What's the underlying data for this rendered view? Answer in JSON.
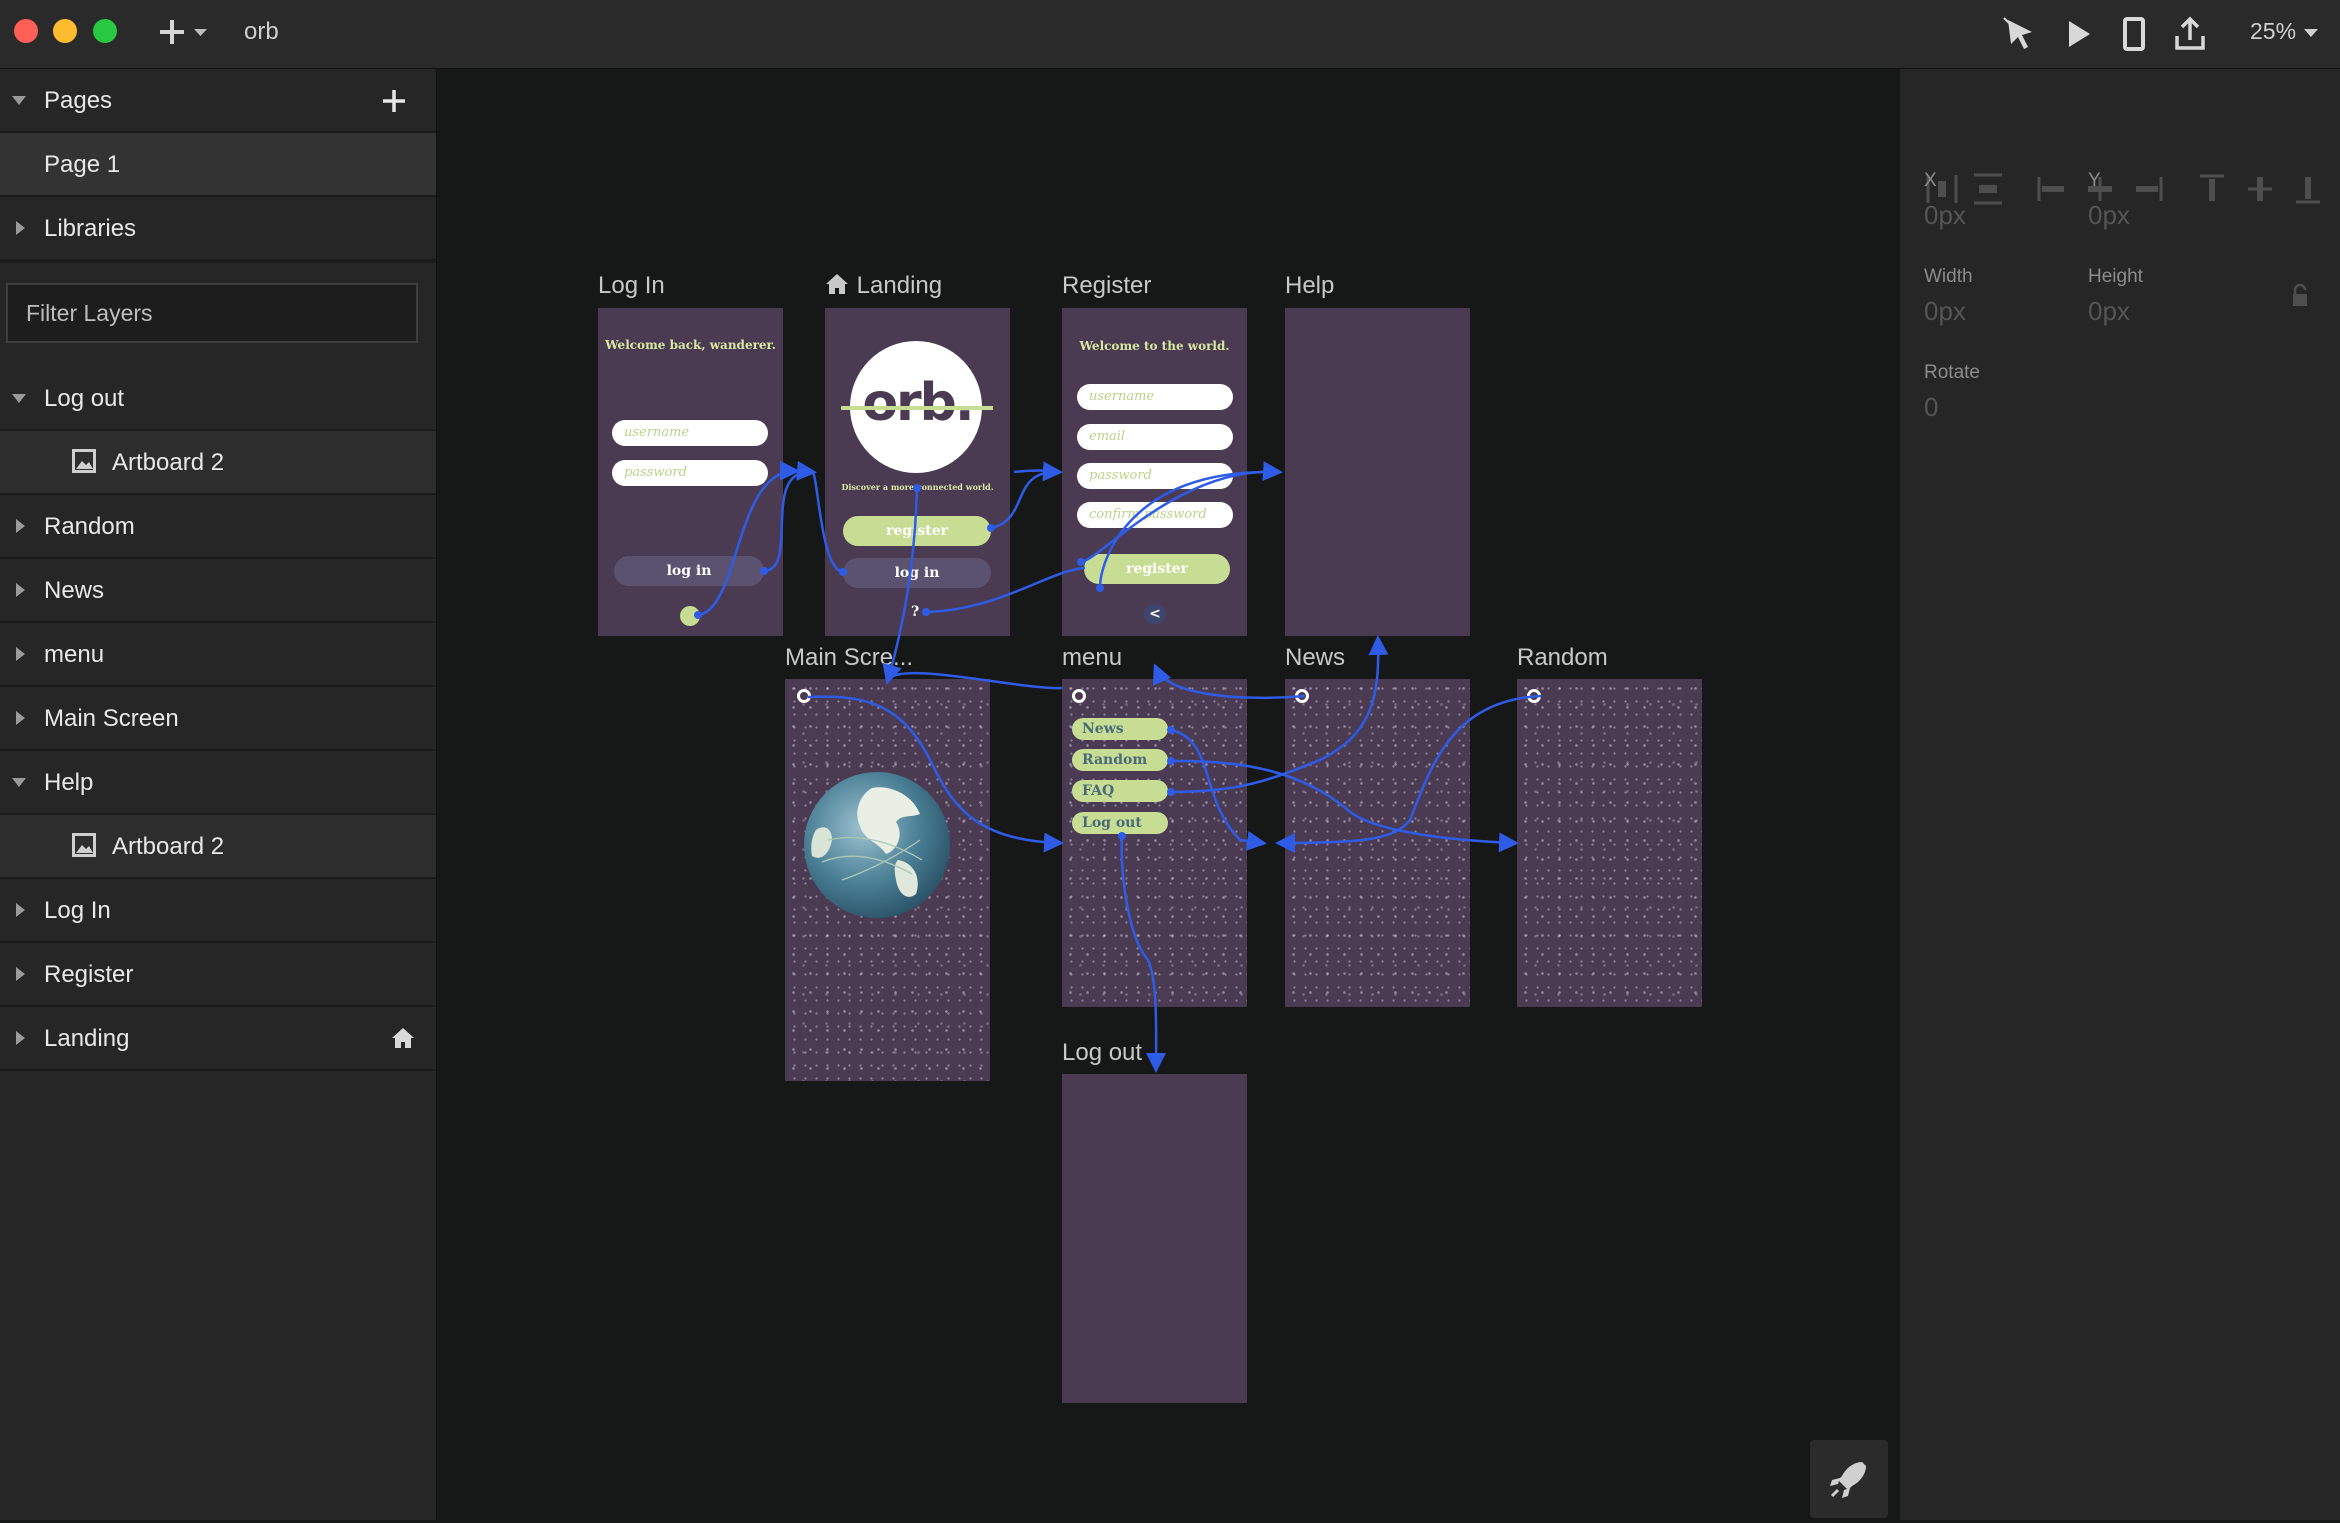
{
  "app": {
    "title": "orb",
    "zoom": "25%"
  },
  "sidebar": {
    "pages_header": "Pages",
    "page_item": "Page 1",
    "libraries": "Libraries",
    "filter_placeholder": "Filter Layers",
    "layers": [
      {
        "label": "Log out",
        "expanded": true
      },
      {
        "label": "Artboard 2",
        "child": true
      },
      {
        "label": "Random"
      },
      {
        "label": "News"
      },
      {
        "label": "menu"
      },
      {
        "label": "Main Screen"
      },
      {
        "label": "Help",
        "expanded": true
      },
      {
        "label": "Artboard 2",
        "child": true
      },
      {
        "label": "Log In"
      },
      {
        "label": "Register"
      },
      {
        "label": "Landing",
        "home": true
      }
    ]
  },
  "inspector": {
    "x_label": "X",
    "x_value": "0px",
    "y_label": "Y",
    "y_value": "0px",
    "width_label": "Width",
    "width_value": "0px",
    "height_label": "Height",
    "height_value": "0px",
    "rotate_label": "Rotate",
    "rotate_value": "0"
  },
  "artboards": {
    "login": {
      "title": "Log In",
      "heading": "Welcome back, wanderer.",
      "username_placeholder": "username",
      "password_placeholder": "password",
      "login_button": "log in"
    },
    "landing": {
      "title": "Landing",
      "logo": "orb.",
      "tagline": "Discover a more connected world.",
      "register_button": "register",
      "login_button": "log in",
      "help_glyph": "?"
    },
    "register": {
      "title": "Register",
      "heading": "Welcome to the world.",
      "username_placeholder": "username",
      "email_placeholder": "email",
      "password_placeholder": "password",
      "confirm_placeholder": "confirm password",
      "register_button": "register",
      "back_glyph": "<"
    },
    "help": {
      "title": "Help"
    },
    "main": {
      "title": "Main Scre..."
    },
    "menu": {
      "title": "menu",
      "items": [
        "News",
        "Random",
        "FAQ",
        "Log out"
      ]
    },
    "news": {
      "title": "News"
    },
    "random": {
      "title": "Random"
    },
    "logout": {
      "title": "Log out"
    }
  },
  "colors": {
    "artboard": "#4a3b53",
    "accent_green": "#c7dd94",
    "wire_blue": "#2f5ce6",
    "panel": "#262626",
    "canvas": "#161717"
  },
  "icons": {
    "toolbar": [
      "plus-icon",
      "select-arrow-icon",
      "play-icon",
      "device-icon",
      "share-icon"
    ],
    "fab": "rocket-icon"
  }
}
